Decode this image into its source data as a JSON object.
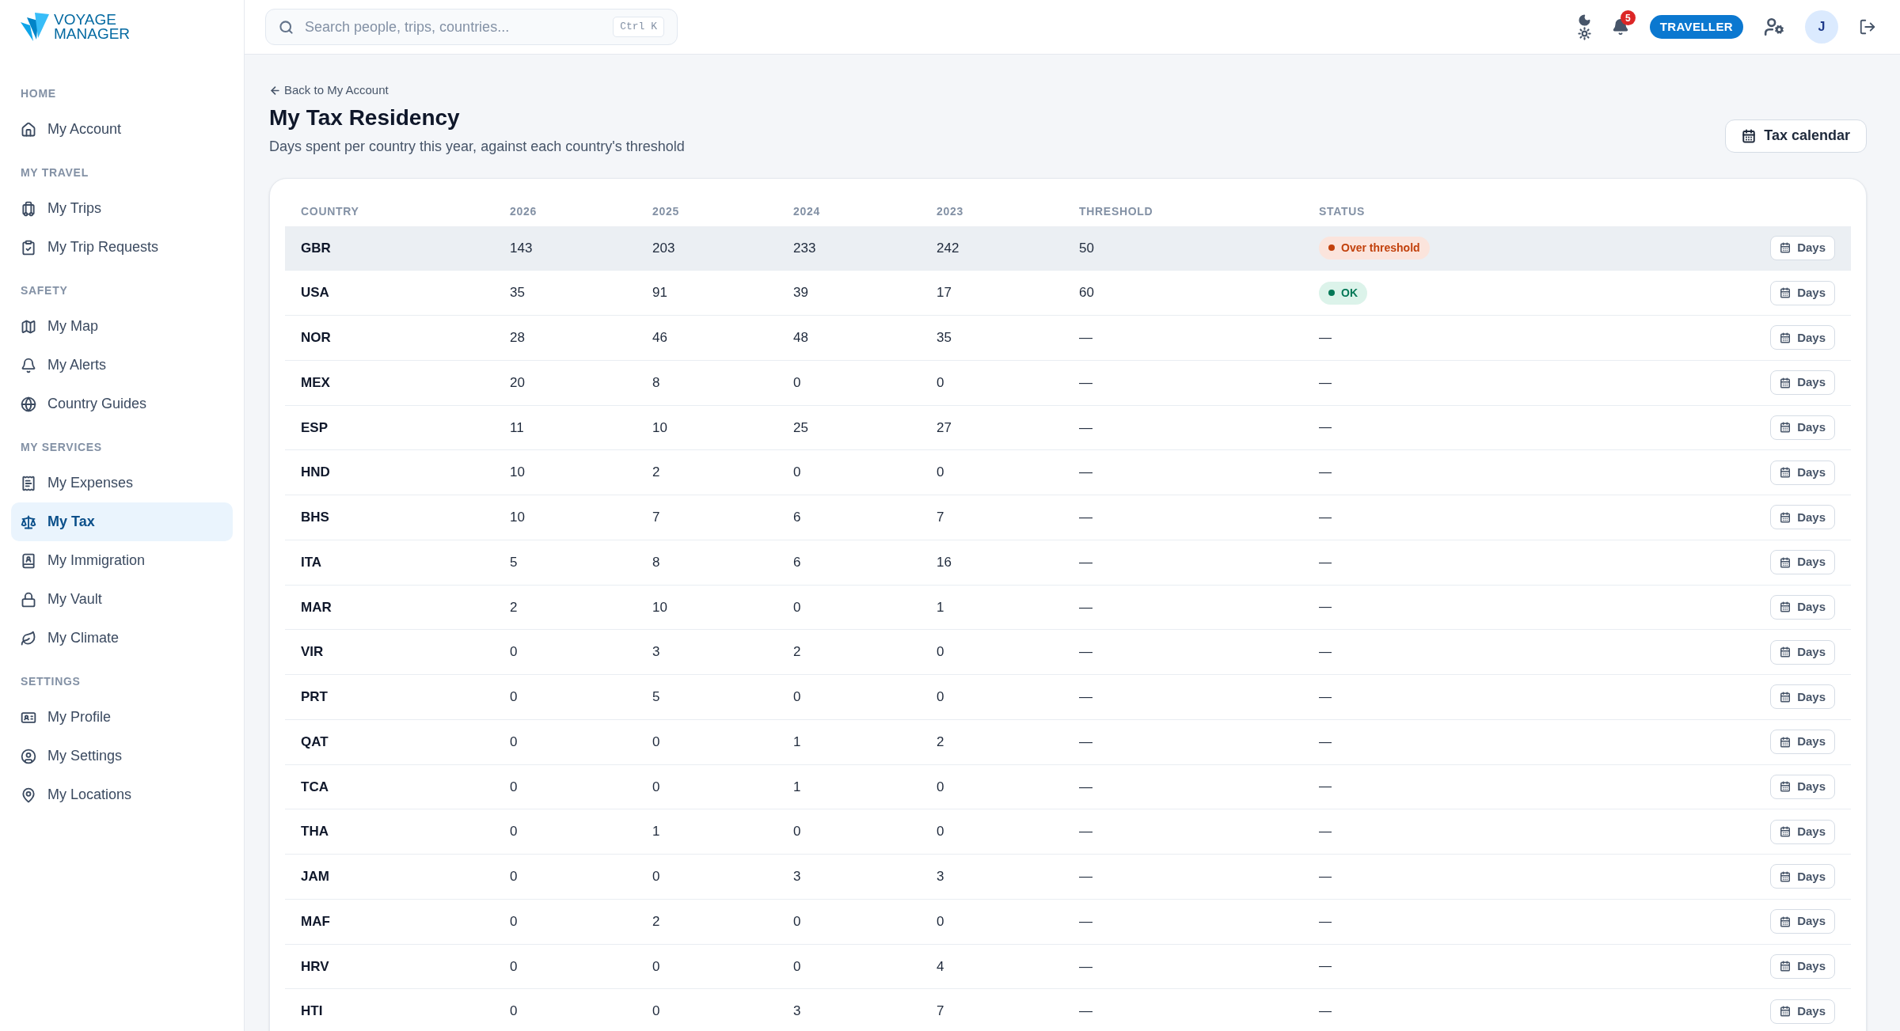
{
  "logo": {
    "line1": "VOYAGE",
    "line2": "MANAGER"
  },
  "sidebar": {
    "sections": [
      {
        "title": "HOME",
        "items": [
          {
            "label": "My Account",
            "selected": false
          }
        ]
      },
      {
        "title": "MY TRAVEL",
        "items": [
          {
            "label": "My Trips",
            "selected": false
          },
          {
            "label": "My Trip Requests",
            "selected": false
          }
        ]
      },
      {
        "title": "SAFETY",
        "items": [
          {
            "label": "My Map",
            "selected": false
          },
          {
            "label": "My Alerts",
            "selected": false
          },
          {
            "label": "Country Guides",
            "selected": false
          }
        ]
      },
      {
        "title": "MY SERVICES",
        "items": [
          {
            "label": "My Expenses",
            "selected": false
          },
          {
            "label": "My Tax",
            "selected": true
          },
          {
            "label": "My Immigration",
            "selected": false
          },
          {
            "label": "My Vault",
            "selected": false
          },
          {
            "label": "My Climate",
            "selected": false
          }
        ]
      },
      {
        "title": "SETTINGS",
        "items": [
          {
            "label": "My Profile",
            "selected": false
          },
          {
            "label": "My Settings",
            "selected": false
          },
          {
            "label": "My Locations",
            "selected": false
          }
        ]
      }
    ]
  },
  "topbar": {
    "search": {
      "placeholder": "Search people, trips, countries...",
      "shortcut": "Ctrl K"
    },
    "notifications": "5",
    "role": "TRAVELLER",
    "avatar": "J"
  },
  "page": {
    "back_link": "Back to My Account",
    "title": "My Tax Residency",
    "subtitle": "Days spent per country this year, against each country's threshold",
    "action": "Tax calendar"
  },
  "table": {
    "columns": [
      "COUNTRY",
      "2026",
      "2025",
      "2024",
      "2023",
      "THRESHOLD",
      "STATUS"
    ],
    "rows": [
      {
        "cells": [
          "GBR",
          "143",
          "203",
          "233",
          "242",
          "50"
        ],
        "status": {
          "kind": "over",
          "label": "Over threshold"
        },
        "button": "Days",
        "selected": true
      },
      {
        "cells": [
          "USA",
          "35",
          "91",
          "39",
          "17",
          "60"
        ],
        "status": {
          "kind": "ok",
          "label": "OK"
        },
        "button": "Days",
        "selected": false
      },
      {
        "cells": [
          "NOR",
          "28",
          "46",
          "48",
          "35",
          "—"
        ],
        "status": {
          "kind": "none",
          "label": "—"
        },
        "button": "Days",
        "selected": false
      },
      {
        "cells": [
          "MEX",
          "20",
          "8",
          "0",
          "0",
          "—"
        ],
        "status": {
          "kind": "none",
          "label": "—"
        },
        "button": "Days",
        "selected": false
      },
      {
        "cells": [
          "ESP",
          "11",
          "10",
          "25",
          "27",
          "—"
        ],
        "status": {
          "kind": "none",
          "label": "—"
        },
        "button": "Days",
        "selected": false
      },
      {
        "cells": [
          "HND",
          "10",
          "2",
          "0",
          "0",
          "—"
        ],
        "status": {
          "kind": "none",
          "label": "—"
        },
        "button": "Days",
        "selected": false
      },
      {
        "cells": [
          "BHS",
          "10",
          "7",
          "6",
          "7",
          "—"
        ],
        "status": {
          "kind": "none",
          "label": "—"
        },
        "button": "Days",
        "selected": false
      },
      {
        "cells": [
          "ITA",
          "5",
          "8",
          "6",
          "16",
          "—"
        ],
        "status": {
          "kind": "none",
          "label": "—"
        },
        "button": "Days",
        "selected": false
      },
      {
        "cells": [
          "MAR",
          "2",
          "10",
          "0",
          "1",
          "—"
        ],
        "status": {
          "kind": "none",
          "label": "—"
        },
        "button": "Days",
        "selected": false
      },
      {
        "cells": [
          "VIR",
          "0",
          "3",
          "2",
          "0",
          "—"
        ],
        "status": {
          "kind": "none",
          "label": "—"
        },
        "button": "Days",
        "selected": false
      },
      {
        "cells": [
          "PRT",
          "0",
          "5",
          "0",
          "0",
          "—"
        ],
        "status": {
          "kind": "none",
          "label": "—"
        },
        "button": "Days",
        "selected": false
      },
      {
        "cells": [
          "QAT",
          "0",
          "0",
          "1",
          "2",
          "—"
        ],
        "status": {
          "kind": "none",
          "label": "—"
        },
        "button": "Days",
        "selected": false
      },
      {
        "cells": [
          "TCA",
          "0",
          "0",
          "1",
          "0",
          "—"
        ],
        "status": {
          "kind": "none",
          "label": "—"
        },
        "button": "Days",
        "selected": false
      },
      {
        "cells": [
          "THA",
          "0",
          "1",
          "0",
          "0",
          "—"
        ],
        "status": {
          "kind": "none",
          "label": "—"
        },
        "button": "Days",
        "selected": false
      },
      {
        "cells": [
          "JAM",
          "0",
          "0",
          "3",
          "3",
          "—"
        ],
        "status": {
          "kind": "none",
          "label": "—"
        },
        "button": "Days",
        "selected": false
      },
      {
        "cells": [
          "MAF",
          "0",
          "2",
          "0",
          "0",
          "—"
        ],
        "status": {
          "kind": "none",
          "label": "—"
        },
        "button": "Days",
        "selected": false
      },
      {
        "cells": [
          "HRV",
          "0",
          "0",
          "0",
          "4",
          "—"
        ],
        "status": {
          "kind": "none",
          "label": "—"
        },
        "button": "Days",
        "selected": false
      },
      {
        "cells": [
          "HTI",
          "0",
          "0",
          "3",
          "7",
          "—"
        ],
        "status": {
          "kind": "none",
          "label": "—"
        },
        "button": "Days",
        "selected": false
      }
    ]
  }
}
